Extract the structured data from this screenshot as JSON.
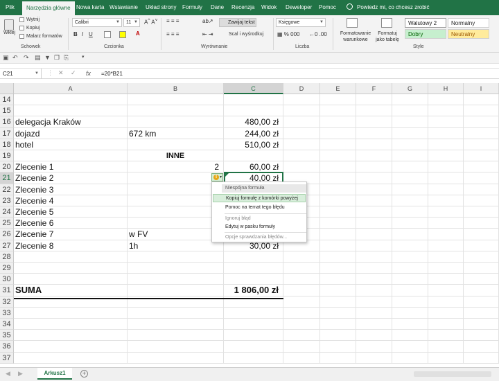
{
  "ribbon": {
    "tabs": [
      "Plik",
      "Narzędzia główne",
      "Nowa karta",
      "Wstawianie",
      "Układ strony",
      "Formuły",
      "Dane",
      "Recenzja",
      "Widok",
      "Deweloper",
      "Pomoc"
    ],
    "tell_me": "Powiedz mi, co chcesz zrobić",
    "clipboard": {
      "paste": "Wklej",
      "cut": "Wytnij",
      "copy": "Kopiuj",
      "painter": "Malarz formatów",
      "group": "Schowek"
    },
    "font": {
      "name": "Calibri",
      "size": "11",
      "group": "Czcionka"
    },
    "alignment": {
      "wrap": "Zawijaj tekst",
      "merge": "Scal i wyśrodkuj",
      "group": "Wyrównanie"
    },
    "number": {
      "format": "Księgowe",
      "group": "Liczba"
    },
    "styles": {
      "conditional": "Formatowanie warunkowe",
      "table": "Formatuj jako tabelę",
      "waluty": "Walutowy 2",
      "normalny": "Normalny",
      "dobry": "Dobry",
      "neutralny": "Neutralny",
      "group": "Style"
    },
    "colors": {
      "excel_green": "#217346",
      "good_bg": "#c6efce",
      "neutral_bg": "#ffeb9c"
    }
  },
  "formula_bar": {
    "name_box": "C21",
    "formula": "=20*B21"
  },
  "columns": [
    "A",
    "B",
    "C",
    "D",
    "E",
    "F",
    "G",
    "H",
    "I"
  ],
  "rows": [
    {
      "n": "14",
      "a": "",
      "b": "",
      "c": ""
    },
    {
      "n": "15",
      "a": "",
      "b": "",
      "c": ""
    },
    {
      "n": "16",
      "a": "delegacja Kraków",
      "b": "",
      "c": "480,00 zł"
    },
    {
      "n": "17",
      "a": "dojazd",
      "b": "672 km",
      "c": "244,00 zł"
    },
    {
      "n": "18",
      "a": "hotel",
      "b": "",
      "c": "510,00 zł"
    },
    {
      "n": "19",
      "a": "",
      "b": "INNE",
      "c": ""
    },
    {
      "n": "20",
      "a": "Zlecenie 1",
      "b": "2",
      "c": "60,00 zł"
    },
    {
      "n": "21",
      "a": "Zlecenie 2",
      "b": "",
      "c": "40,00 zł"
    },
    {
      "n": "22",
      "a": "Zlecenie 3",
      "b": "",
      "c": ""
    },
    {
      "n": "23",
      "a": "Zlecenie 4",
      "b": "",
      "c": ""
    },
    {
      "n": "24",
      "a": "Zlecenie 5",
      "b": "",
      "c": ""
    },
    {
      "n": "25",
      "a": "Zlecenie 6",
      "b": "",
      "c": ""
    },
    {
      "n": "26",
      "a": "Zlecenie 7",
      "b": "w FV",
      "c": ""
    },
    {
      "n": "27",
      "a": "Zlecenie 8",
      "b": "1h",
      "c": "30,00 zł"
    },
    {
      "n": "28",
      "a": "",
      "b": "",
      "c": ""
    },
    {
      "n": "29",
      "a": "",
      "b": "",
      "c": ""
    },
    {
      "n": "30",
      "a": "",
      "b": "",
      "c": ""
    },
    {
      "n": "31",
      "a": "SUMA",
      "b": "",
      "c": "1 806,00 zł"
    },
    {
      "n": "32",
      "a": "",
      "b": "",
      "c": ""
    },
    {
      "n": "33",
      "a": "",
      "b": "",
      "c": ""
    },
    {
      "n": "34",
      "a": "",
      "b": "",
      "c": ""
    },
    {
      "n": "35",
      "a": "",
      "b": "",
      "c": ""
    },
    {
      "n": "36",
      "a": "",
      "b": "",
      "c": ""
    },
    {
      "n": "37",
      "a": "",
      "b": "",
      "c": ""
    }
  ],
  "error_menu": {
    "title": "Niespójna formuła",
    "items": [
      "Kopiuj formułę z komórki powyżej",
      "Pomoc na temat tego błędu",
      "Ignoruj błąd",
      "Edytuj w pasku formuły",
      "Opcje sprawdzania błędów..."
    ]
  },
  "sheet_tab": "Arkusz1"
}
